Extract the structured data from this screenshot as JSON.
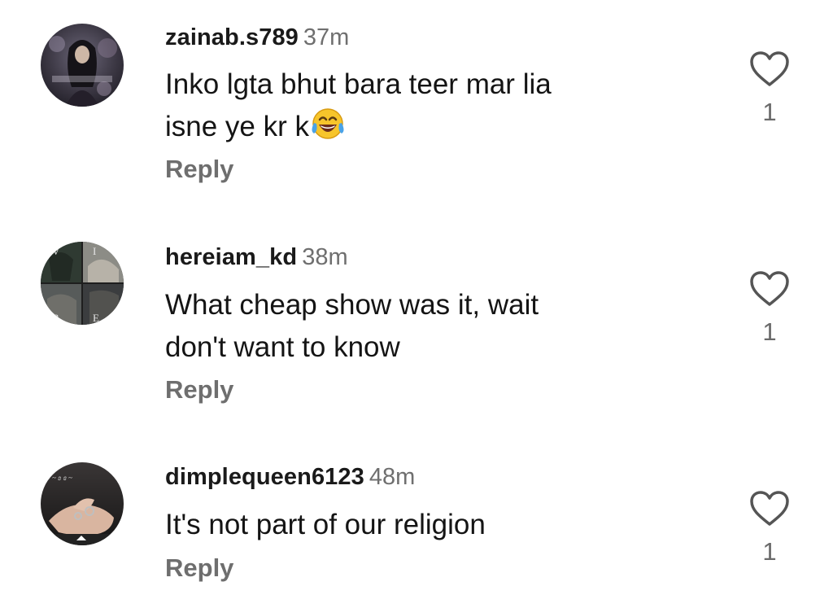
{
  "comments": [
    {
      "username": "zainab.s789",
      "time": "37m",
      "text_lines": [
        "Inko lgta bhut bara teer mar lia",
        "isne ye kr k"
      ],
      "emoji": "face-with-tears-of-joy",
      "reply_label": "Reply",
      "like_count": "1"
    },
    {
      "username": "hereiam_kd",
      "time": "38m",
      "text_lines": [
        "What cheap show was it, wait",
        "don't want to know"
      ],
      "reply_label": "Reply",
      "like_count": "1"
    },
    {
      "username": "dimplequeen6123",
      "time": "48m",
      "text_lines": [
        "It's not part of our religion"
      ],
      "reply_label": "Reply",
      "like_count": "1"
    }
  ],
  "icons": {
    "like": "heart-outline-icon"
  },
  "colors": {
    "username": "#1a1a1a",
    "time": "#6f6f6f",
    "reply": "#6e6e6e",
    "like_count": "#6a6a6a"
  }
}
